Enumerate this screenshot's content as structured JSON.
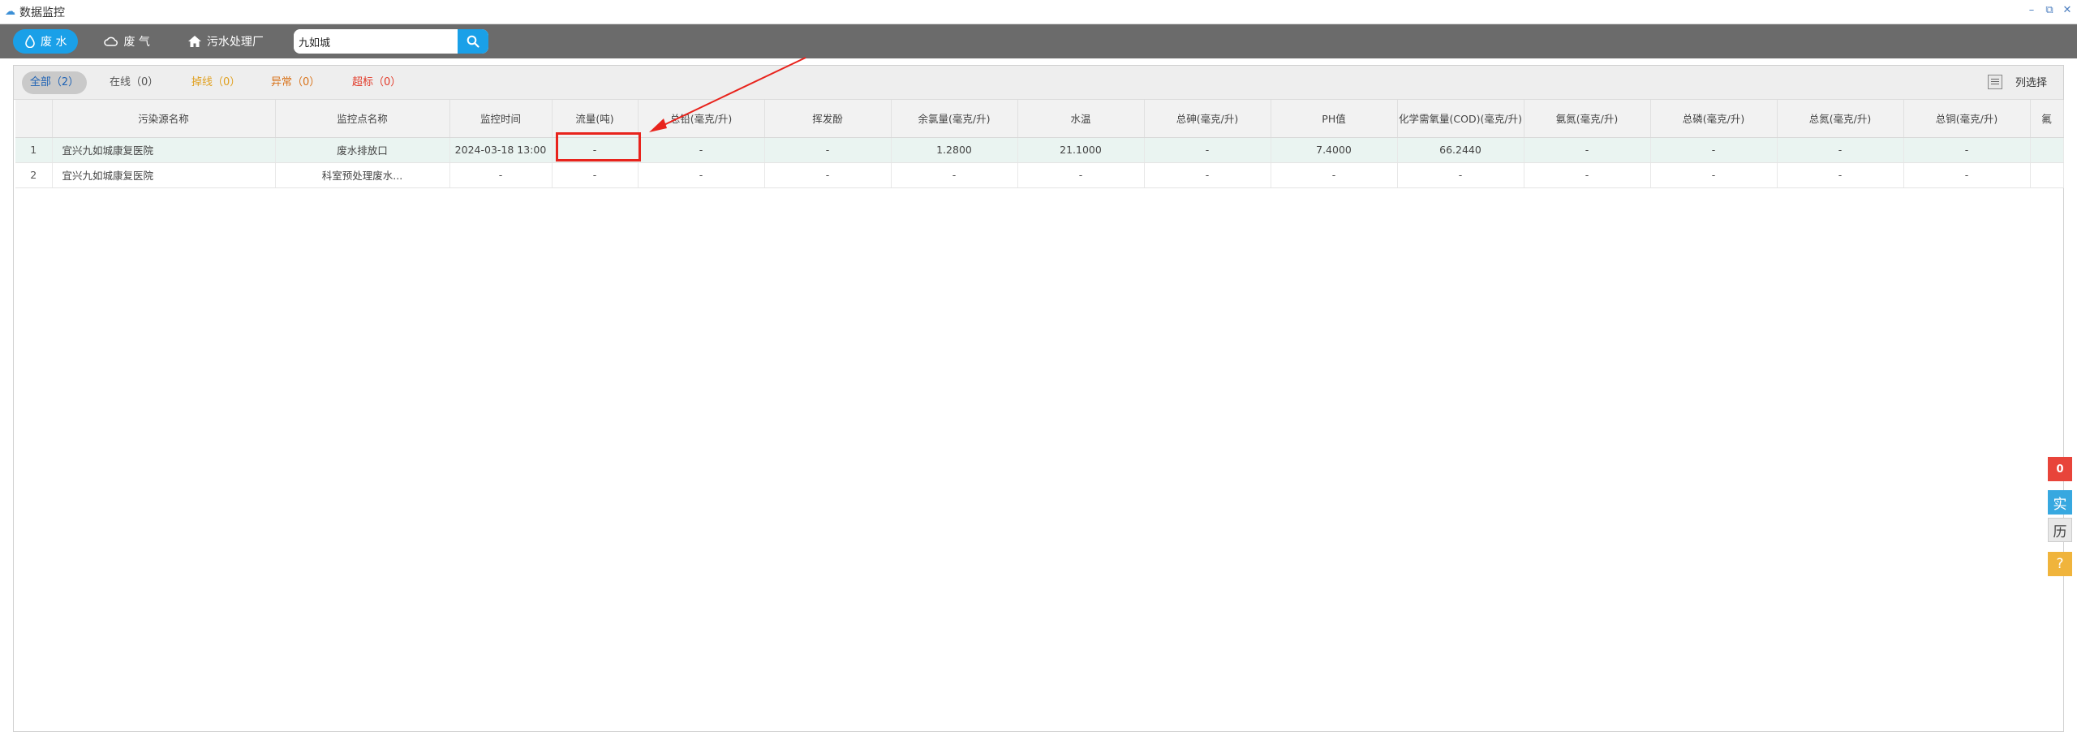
{
  "window": {
    "title": "数据监控",
    "controls": [
      "–",
      "⧉",
      "✕"
    ]
  },
  "toolbar": {
    "tabs": [
      {
        "label": "废 水",
        "icon": "drop-icon",
        "active": true
      },
      {
        "label": "废 气",
        "icon": "cloud-icon",
        "active": false
      },
      {
        "label": "污水处理厂",
        "icon": "house-icon",
        "active": false
      }
    ],
    "search": {
      "value": "九如城",
      "placeholder": ""
    },
    "accent": "#1aa0e8"
  },
  "filters": {
    "all": "全部（2）",
    "online": "在线（0）",
    "offline": "掉线（0）",
    "abnormal": "异常（0）",
    "over": "超标（0）",
    "column_select": "列选择"
  },
  "table": {
    "headers": [
      "",
      "污染源名称",
      "监控点名称",
      "监控时间",
      "流量(吨)",
      "总铅(毫克/升)",
      "挥发酚",
      "余氯量(毫克/升)",
      "水温",
      "总砷(毫克/升)",
      "PH值",
      "化学需氧量(COD)(毫克/升)",
      "氨氮(毫克/升)",
      "总磷(毫克/升)",
      "总氮(毫克/升)",
      "总铜(毫克/升)",
      "氟"
    ],
    "rows": [
      [
        "1",
        "宜兴九如城康复医院",
        "废水排放口",
        "2024-03-18 13:00",
        "-",
        "-",
        "-",
        "1.2800",
        "21.1000",
        "-",
        "7.4000",
        "66.2440",
        "-",
        "-",
        "-",
        "-",
        ""
      ],
      [
        "2",
        "宜兴九如城康复医院",
        "科室预处理废水...",
        "-",
        "-",
        "-",
        "-",
        "-",
        "-",
        "-",
        "-",
        "-",
        "-",
        "-",
        "-",
        "-",
        ""
      ]
    ]
  },
  "side": {
    "count": "0",
    "realtime": "实",
    "history": "历",
    "help": "?"
  },
  "annotation_color": "#e8231c"
}
